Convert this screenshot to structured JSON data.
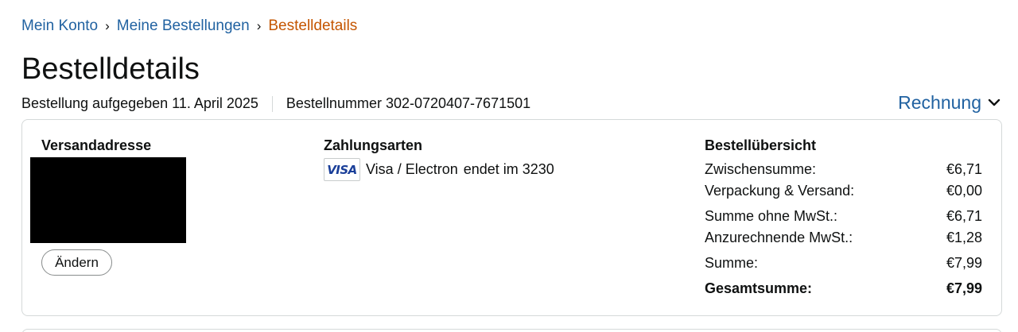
{
  "breadcrumb": {
    "items": [
      "Mein Konto",
      "Meine Bestellungen"
    ],
    "current": "Bestelldetails",
    "separator": "›"
  },
  "page": {
    "title": "Bestelldetails",
    "order_date": "Bestellung aufgegeben 11. April 2025",
    "order_number": "Bestellnummer 302-0720407-7671501",
    "invoice_label": "Rechnung"
  },
  "shipping": {
    "title": "Versandadresse",
    "change_label": "Ändern"
  },
  "payment": {
    "title": "Zahlungsarten",
    "card_logo": "VISA",
    "method": "Visa / Electron",
    "ending": "endet im 3230"
  },
  "summary": {
    "title": "Bestellübersicht",
    "rows": [
      {
        "label": "Zwischensumme:",
        "value": "€6,71"
      },
      {
        "label": "Verpackung & Versand:",
        "value": "€0,00"
      },
      {
        "label": "Summe ohne MwSt.:",
        "value": "€6,71"
      },
      {
        "label": "Anzurechnende MwSt.:",
        "value": "€1,28"
      },
      {
        "label": "Summe:",
        "value": "€7,99"
      },
      {
        "label": "Gesamtsumme:",
        "value": "€7,99"
      }
    ]
  },
  "colors": {
    "link": "#2162a1",
    "current_crumb": "#c45500",
    "text": "#0f1111",
    "border": "#d5d9d9",
    "visa": "#1a3f99"
  }
}
